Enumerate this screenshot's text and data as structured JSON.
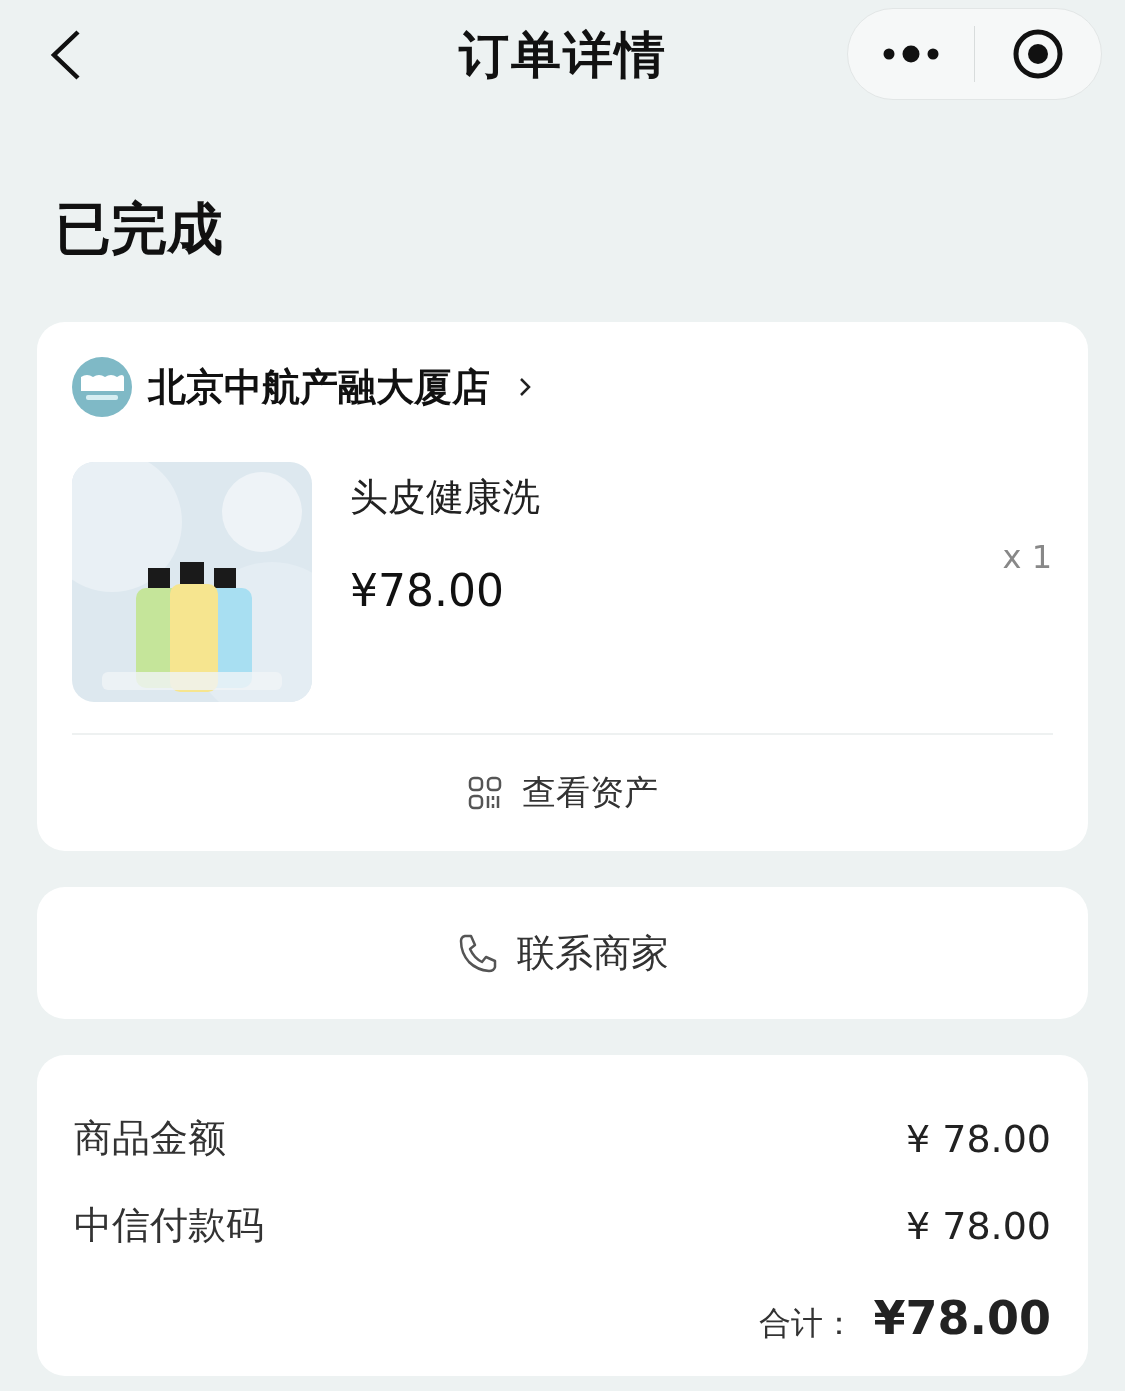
{
  "nav": {
    "title": "订单详情"
  },
  "status": "已完成",
  "store": {
    "name": "北京中航产融大厦店"
  },
  "product": {
    "name": "头皮健康洗",
    "price": "¥78.00",
    "quantity": "x 1"
  },
  "assets_link": "查看资产",
  "contact_button": "联系商家",
  "summary": {
    "rows": [
      {
        "label": "商品金额",
        "value": "¥ 78.00"
      },
      {
        "label": "中信付款码",
        "value": "¥ 78.00"
      }
    ],
    "total_label": "合计：",
    "total_value": "¥78.00"
  }
}
